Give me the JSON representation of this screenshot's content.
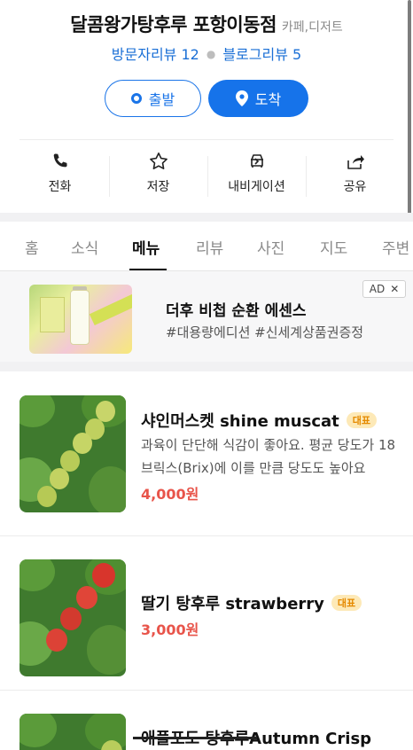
{
  "place": {
    "name": "달콤왕가탕후루 포항이동점",
    "category": "카페,디저트",
    "visitor_reviews": "방문자리뷰 12",
    "blog_reviews": "블로그리뷰 5"
  },
  "route": {
    "depart": "출발",
    "arrive": "도착"
  },
  "actions": [
    {
      "label": "전화",
      "icon": "phone-icon"
    },
    {
      "label": "저장",
      "icon": "star-icon"
    },
    {
      "label": "내비게이션",
      "icon": "navigation-icon"
    },
    {
      "label": "공유",
      "icon": "share-icon"
    }
  ],
  "tabs": [
    "홈",
    "소식",
    "메뉴",
    "리뷰",
    "사진",
    "지도",
    "주변"
  ],
  "active_tab": "메뉴",
  "ad": {
    "title": "더후 비첩 순환 에센스",
    "subtitle": "#대용량에디션 #신세계상품권증정",
    "badge": "AD",
    "close": "✕"
  },
  "menu": [
    {
      "name": "샤인머스켓 shine muscat",
      "badge": "대표",
      "description": "과육이 단단해 식감이 좋아요. 평균 당도가 18브릭스(Brix)에 이를 만큼 당도도 높아요",
      "price": "4,000원"
    },
    {
      "name": "딸기 탕후루 strawberry",
      "badge": "대표",
      "price": "3,000원"
    },
    {
      "name": "애플포도 탕후루Autumn Crisp"
    }
  ],
  "colors": {
    "accent": "#1673ea",
    "price": "#e8544a",
    "badge_bg": "#fde9b7",
    "badge_text": "#e58a00"
  }
}
